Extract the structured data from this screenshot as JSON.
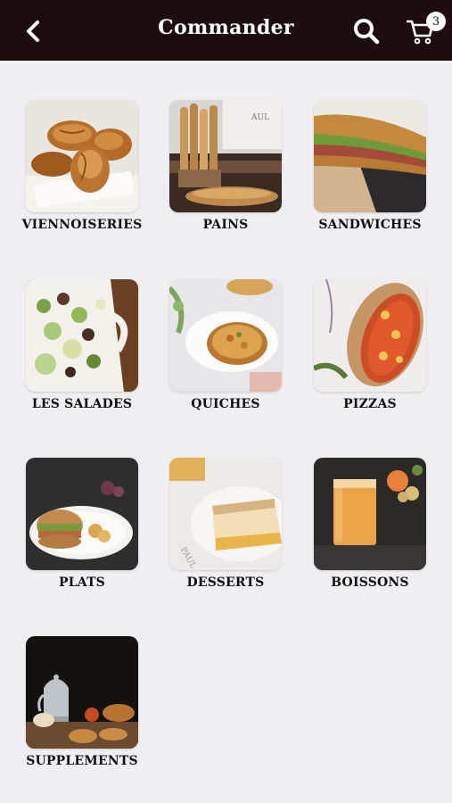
{
  "header": {
    "title": "Commander",
    "cart_count": "3",
    "back_icon": "chevron-left-icon",
    "search_icon": "search-icon",
    "cart_icon": "cart-icon"
  },
  "colors": {
    "header_bg": "#1e0d0e",
    "page_bg": "#efeef2",
    "label_text": "#111111"
  },
  "categories": [
    {
      "label": "VIENNOISERIES"
    },
    {
      "label": "PAINS"
    },
    {
      "label": "SANDWICHES"
    },
    {
      "label": "LES SALADES"
    },
    {
      "label": "QUICHES"
    },
    {
      "label": "PIZZAS"
    },
    {
      "label": "PLATS"
    },
    {
      "label": "DESSERTS"
    },
    {
      "label": "BOISSONS"
    },
    {
      "label": "SUPPLEMENTS"
    }
  ]
}
